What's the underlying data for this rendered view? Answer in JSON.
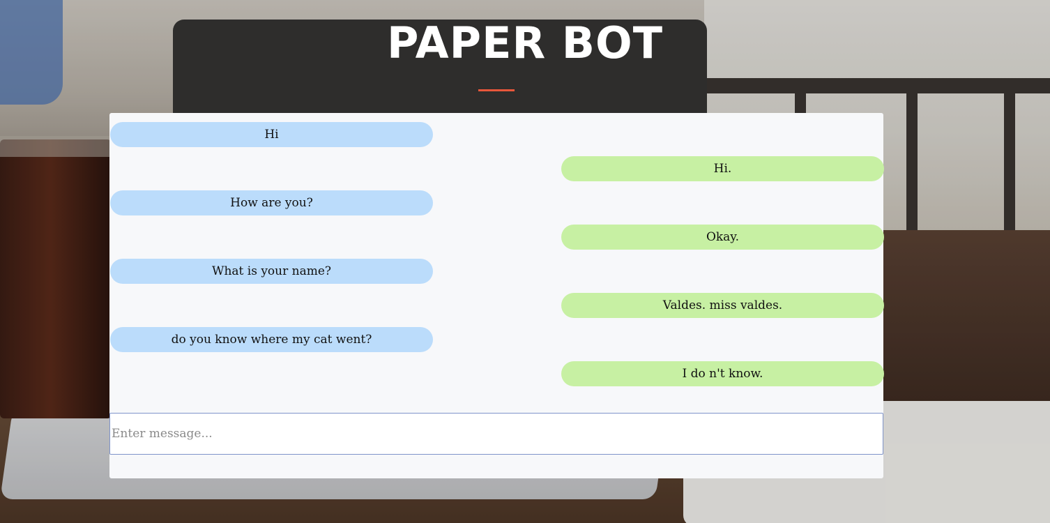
{
  "header": {
    "title": "PAPER BOT"
  },
  "colors": {
    "user_bubble": "#bbdcfb",
    "bot_bubble": "#c7f0a3",
    "accent_underline": "#e8573b",
    "panel_background": "#f7f8fa"
  },
  "messages": [
    {
      "sender": "user",
      "text": "Hi"
    },
    {
      "sender": "bot",
      "text": "Hi."
    },
    {
      "sender": "user",
      "text": "How are you?"
    },
    {
      "sender": "bot",
      "text": "Okay."
    },
    {
      "sender": "user",
      "text": "What is your name?"
    },
    {
      "sender": "bot",
      "text": "Valdes. miss valdes."
    },
    {
      "sender": "user",
      "text": "do you know where my cat went?"
    },
    {
      "sender": "bot",
      "text": "I do n't know."
    }
  ],
  "input": {
    "placeholder": "Enter message...",
    "value": ""
  }
}
